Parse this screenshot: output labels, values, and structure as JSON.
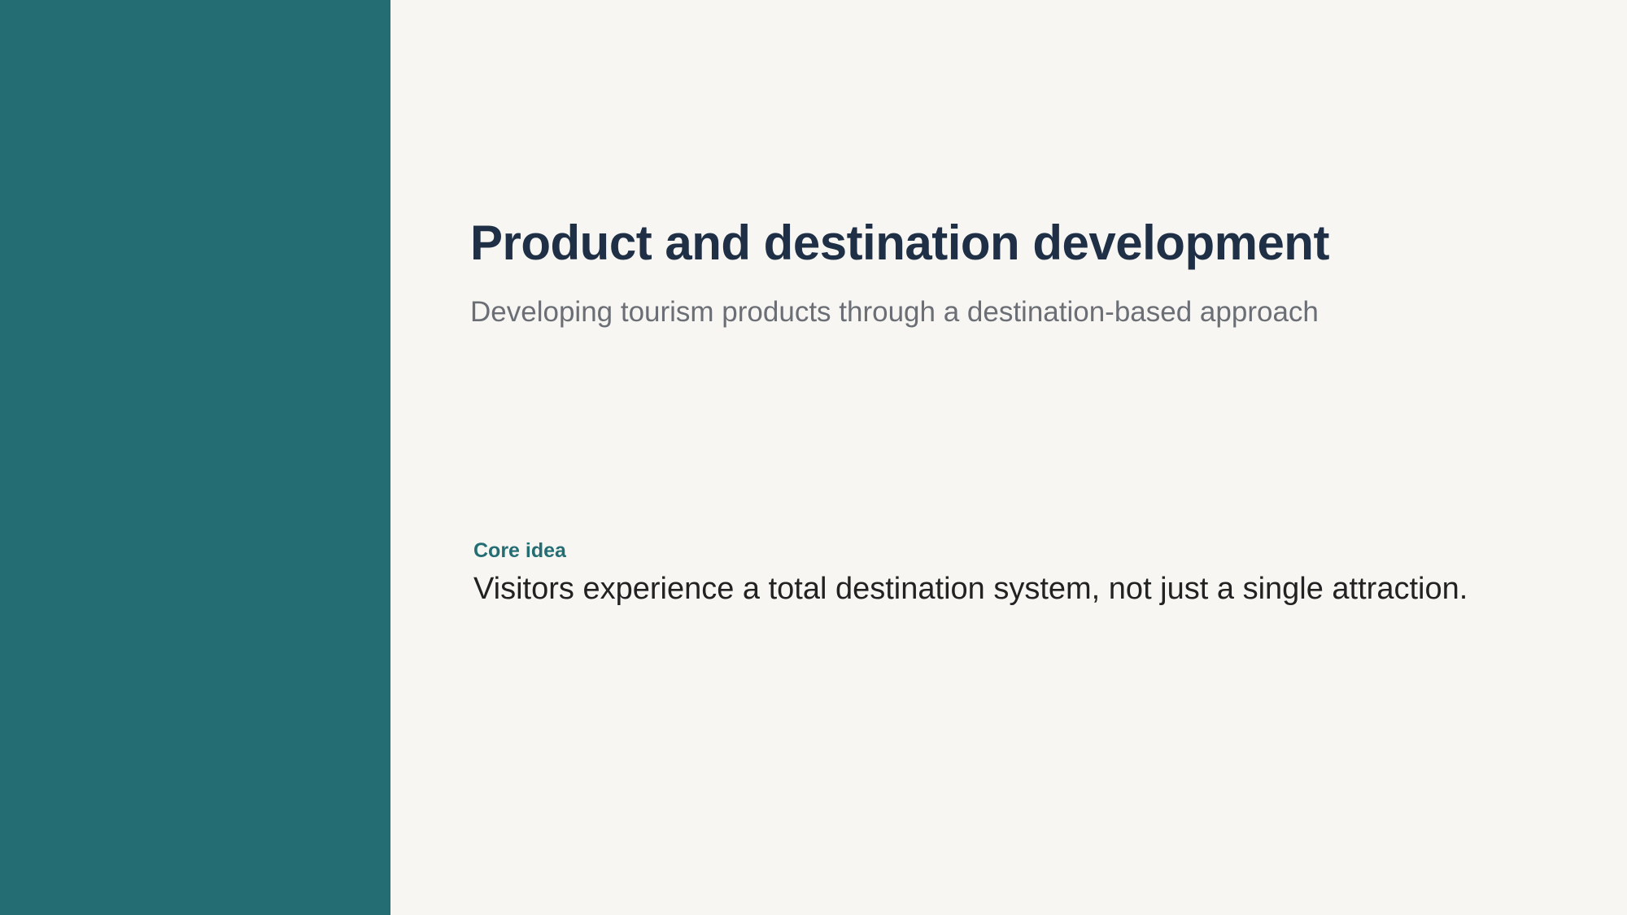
{
  "colors": {
    "side_panel": "#246e73",
    "background": "#f7f6f3",
    "title": "#1f2f45",
    "subtitle": "#6b6f75",
    "accent": "#246e73",
    "body_text": "#222222"
  },
  "slide": {
    "title": "Product and destination development",
    "subtitle": "Developing tourism products through a destination-based approach",
    "core": {
      "label": "Core idea",
      "text": "Visitors experience a total destination system, not just a single attraction."
    }
  }
}
